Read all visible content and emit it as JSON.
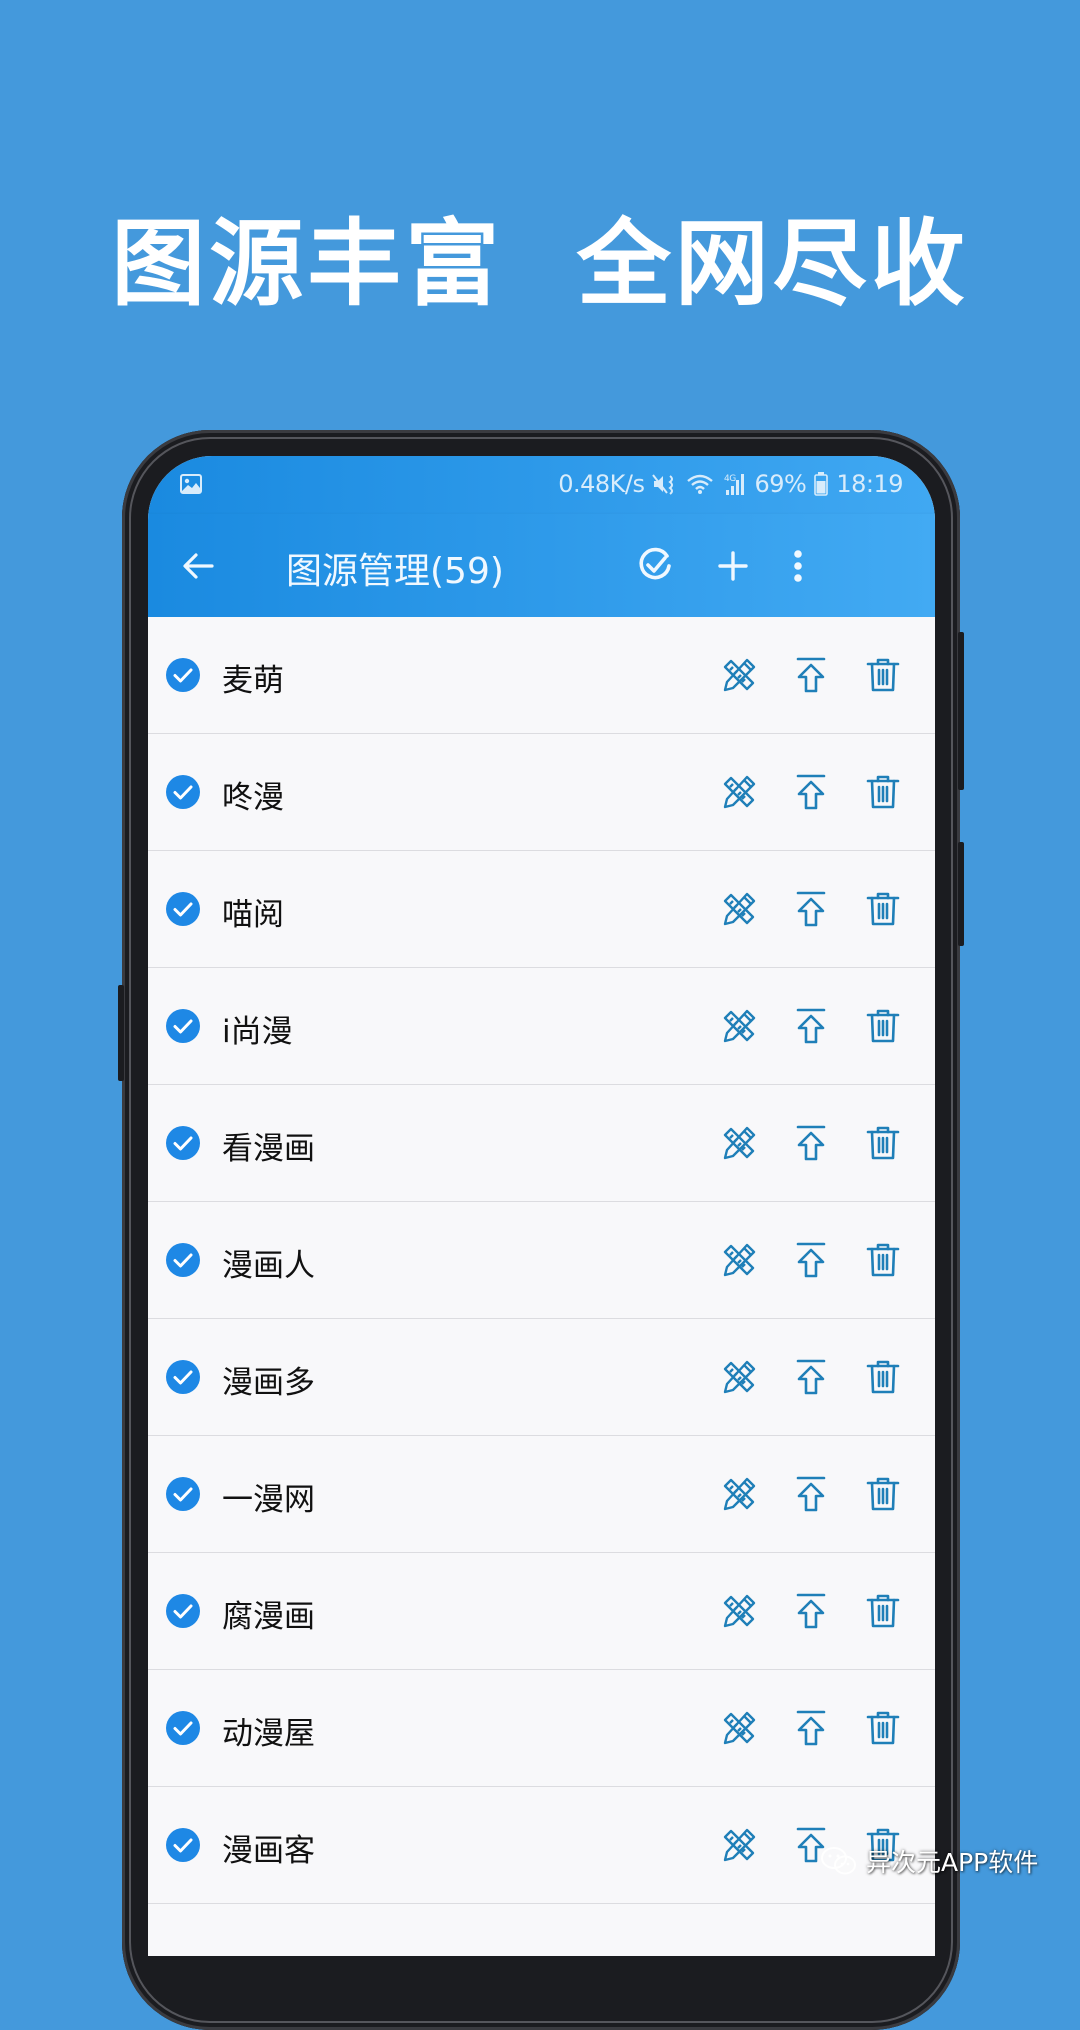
{
  "banner": {
    "headline": "图源丰富  全网尽收"
  },
  "status_bar": {
    "left_icon": "image-icon",
    "net_speed": "0.48K/s",
    "icons": [
      "mute-vibrate-icon",
      "wifi-icon",
      "signal-4g-icon"
    ],
    "battery": "69%",
    "battery_icon": "battery-icon",
    "time": "18:19"
  },
  "app_bar": {
    "back_icon": "arrow-left-icon",
    "title": "图源管理(59)",
    "actions": [
      {
        "name": "select-all",
        "icon": "check-circle-icon"
      },
      {
        "name": "add",
        "icon": "plus-icon"
      },
      {
        "name": "more",
        "icon": "more-vertical-icon"
      }
    ]
  },
  "colors": {
    "background": "#4499dc",
    "app_bar": "#2196f3",
    "checkbox": "#1e88e5",
    "row_icon": "#1f7fb8",
    "row_background": "#f8f8fa",
    "divider": "#dcdce0"
  },
  "sources": [
    {
      "name": "麦萌",
      "checked": true
    },
    {
      "name": "咚漫",
      "checked": true
    },
    {
      "name": "喵阅",
      "checked": true
    },
    {
      "name": "i尚漫",
      "checked": true
    },
    {
      "name": "看漫画",
      "checked": true
    },
    {
      "name": "漫画人",
      "checked": true
    },
    {
      "name": "漫画多",
      "checked": true
    },
    {
      "name": "一漫网",
      "checked": true
    },
    {
      "name": "腐漫画",
      "checked": true
    },
    {
      "name": "动漫屋",
      "checked": true
    },
    {
      "name": "漫画客",
      "checked": true
    }
  ],
  "row_actions": [
    {
      "name": "edit",
      "icon": "pencil-ruler-icon"
    },
    {
      "name": "move-to-top",
      "icon": "arrow-to-top-icon"
    },
    {
      "name": "delete",
      "icon": "trash-icon"
    }
  ],
  "watermark": {
    "icon": "wechat-icon",
    "text": "异次元APP软件"
  }
}
